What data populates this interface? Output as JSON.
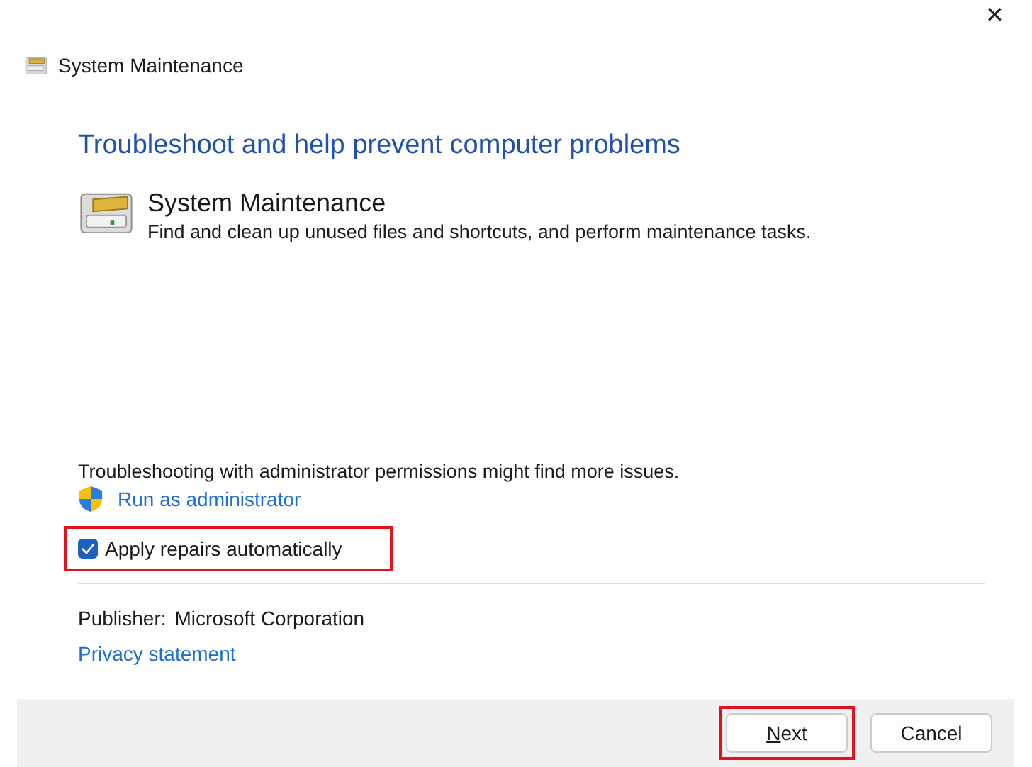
{
  "window": {
    "title": "System Maintenance",
    "close": "✕"
  },
  "heading": "Troubleshoot and help prevent computer problems",
  "troubleshooter": {
    "name": "System Maintenance",
    "description": "Find and clean up unused files and shortcuts, and perform maintenance tasks."
  },
  "admin_note": "Troubleshooting with administrator permissions might find more issues.",
  "run_as_admin": "Run as administrator",
  "apply_repairs": {
    "label": "Apply repairs automatically",
    "checked": true,
    "highlighted": true
  },
  "publisher": {
    "label": "Publisher:",
    "value": "Microsoft Corporation"
  },
  "privacy_link": "Privacy statement",
  "buttons": [
    {
      "label": "Next",
      "underline_first": true,
      "highlighted": true
    },
    {
      "label": "Cancel",
      "underline_first": false,
      "highlighted": false
    }
  ]
}
